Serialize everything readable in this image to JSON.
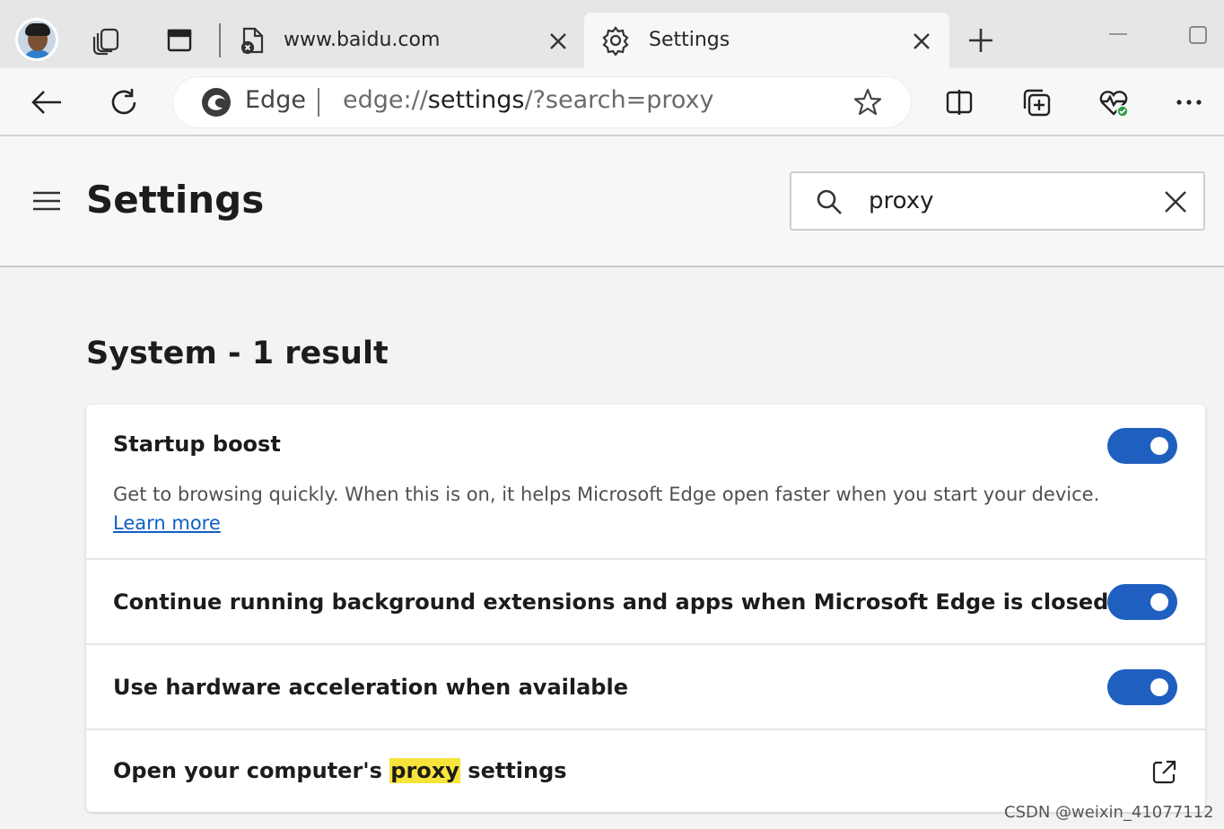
{
  "tabs": {
    "inactive": {
      "title": "www.baidu.com"
    },
    "active": {
      "title": "Settings"
    }
  },
  "address_bar": {
    "badge": "Edge",
    "url_prefix": "edge://",
    "url_host": "settings",
    "url_suffix": "/?search=proxy"
  },
  "header": {
    "title": "Settings",
    "search_value": "proxy"
  },
  "section": {
    "heading": "System - 1 result"
  },
  "settings": [
    {
      "title": "Startup boost",
      "description": "Get to browsing quickly. When this is on, it helps Microsoft Edge open faster when you start your device.",
      "link": "Learn more",
      "enabled": true
    },
    {
      "title": "Continue running background extensions and apps when Microsoft Edge is closed",
      "enabled": true
    },
    {
      "title": "Use hardware acceleration when available",
      "enabled": true
    },
    {
      "title_before": "Open your computer's ",
      "title_match": "proxy",
      "title_after": " settings"
    }
  ],
  "watermark": "CSDN @weixin_41077112",
  "colors": {
    "accent": "#1f5fbf",
    "link": "#0f5fc4",
    "highlight": "#f7e43a",
    "tabstrip": "#e6e6e6",
    "page": "#f3f3f3"
  }
}
